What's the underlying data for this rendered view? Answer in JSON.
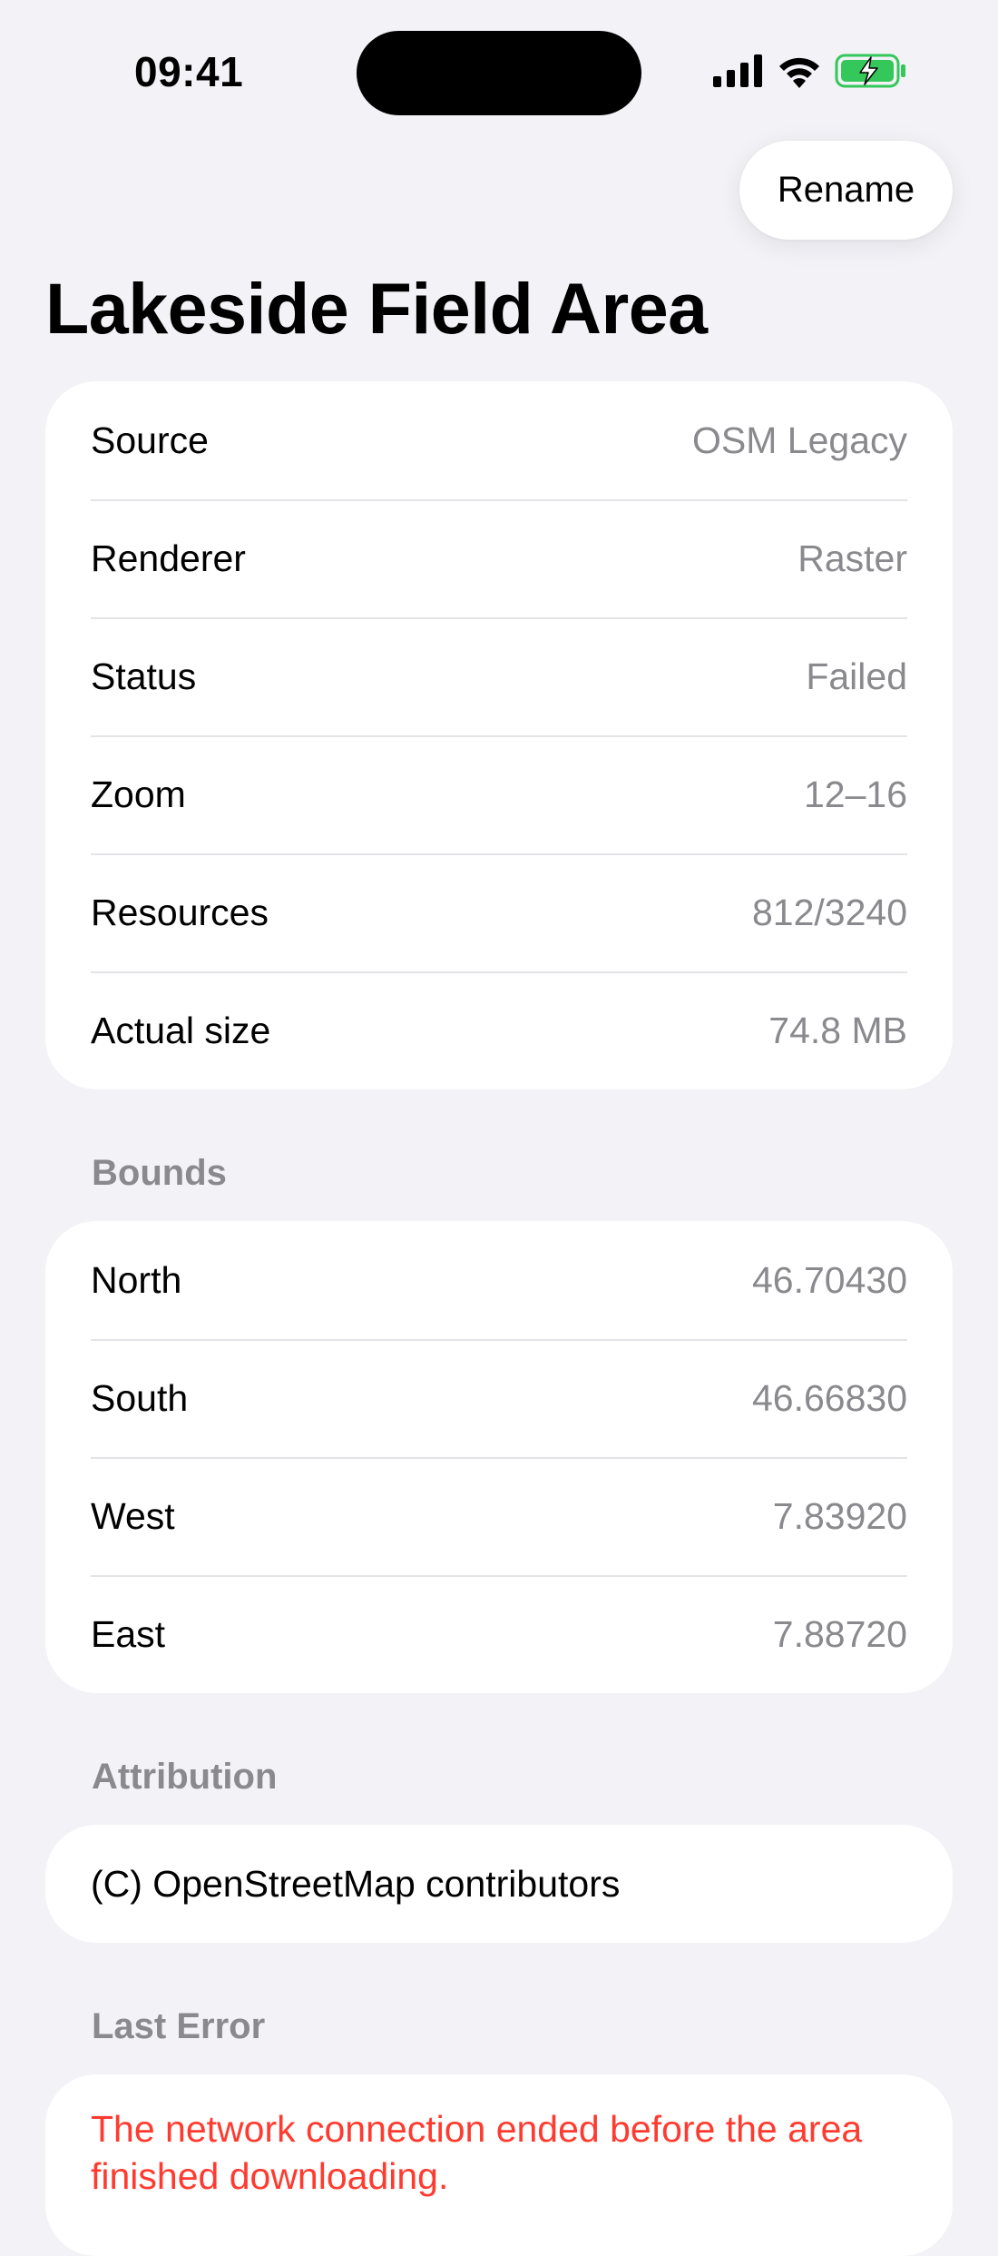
{
  "status_bar": {
    "time": "09:41"
  },
  "toolbar": {
    "rename_label": "Rename"
  },
  "page": {
    "title": "Lakeside Field Area"
  },
  "details": [
    {
      "label": "Source",
      "value": "OSM Legacy"
    },
    {
      "label": "Renderer",
      "value": "Raster"
    },
    {
      "label": "Status",
      "value": "Failed"
    },
    {
      "label": "Zoom",
      "value": "12–16"
    },
    {
      "label": "Resources",
      "value": "812/3240"
    },
    {
      "label": "Actual size",
      "value": "74.8 MB"
    }
  ],
  "bounds": {
    "header": "Bounds",
    "rows": [
      {
        "label": "North",
        "value": "46.70430"
      },
      {
        "label": "South",
        "value": "46.66830"
      },
      {
        "label": "West",
        "value": "7.83920"
      },
      {
        "label": "East",
        "value": "7.88720"
      }
    ]
  },
  "attribution": {
    "header": "Attribution",
    "text": "(C) OpenStreetMap contributors"
  },
  "last_error": {
    "header": "Last Error",
    "text": "The network connection ended before the area finished downloading."
  },
  "colors": {
    "background": "#f2f2f7",
    "card": "#ffffff",
    "secondary_text": "#8a8a8e",
    "error": "#ff3b30",
    "battery_charging": "#34c759"
  },
  "icons": [
    "cellular-signal-icon",
    "wifi-icon",
    "battery-charging-icon"
  ]
}
